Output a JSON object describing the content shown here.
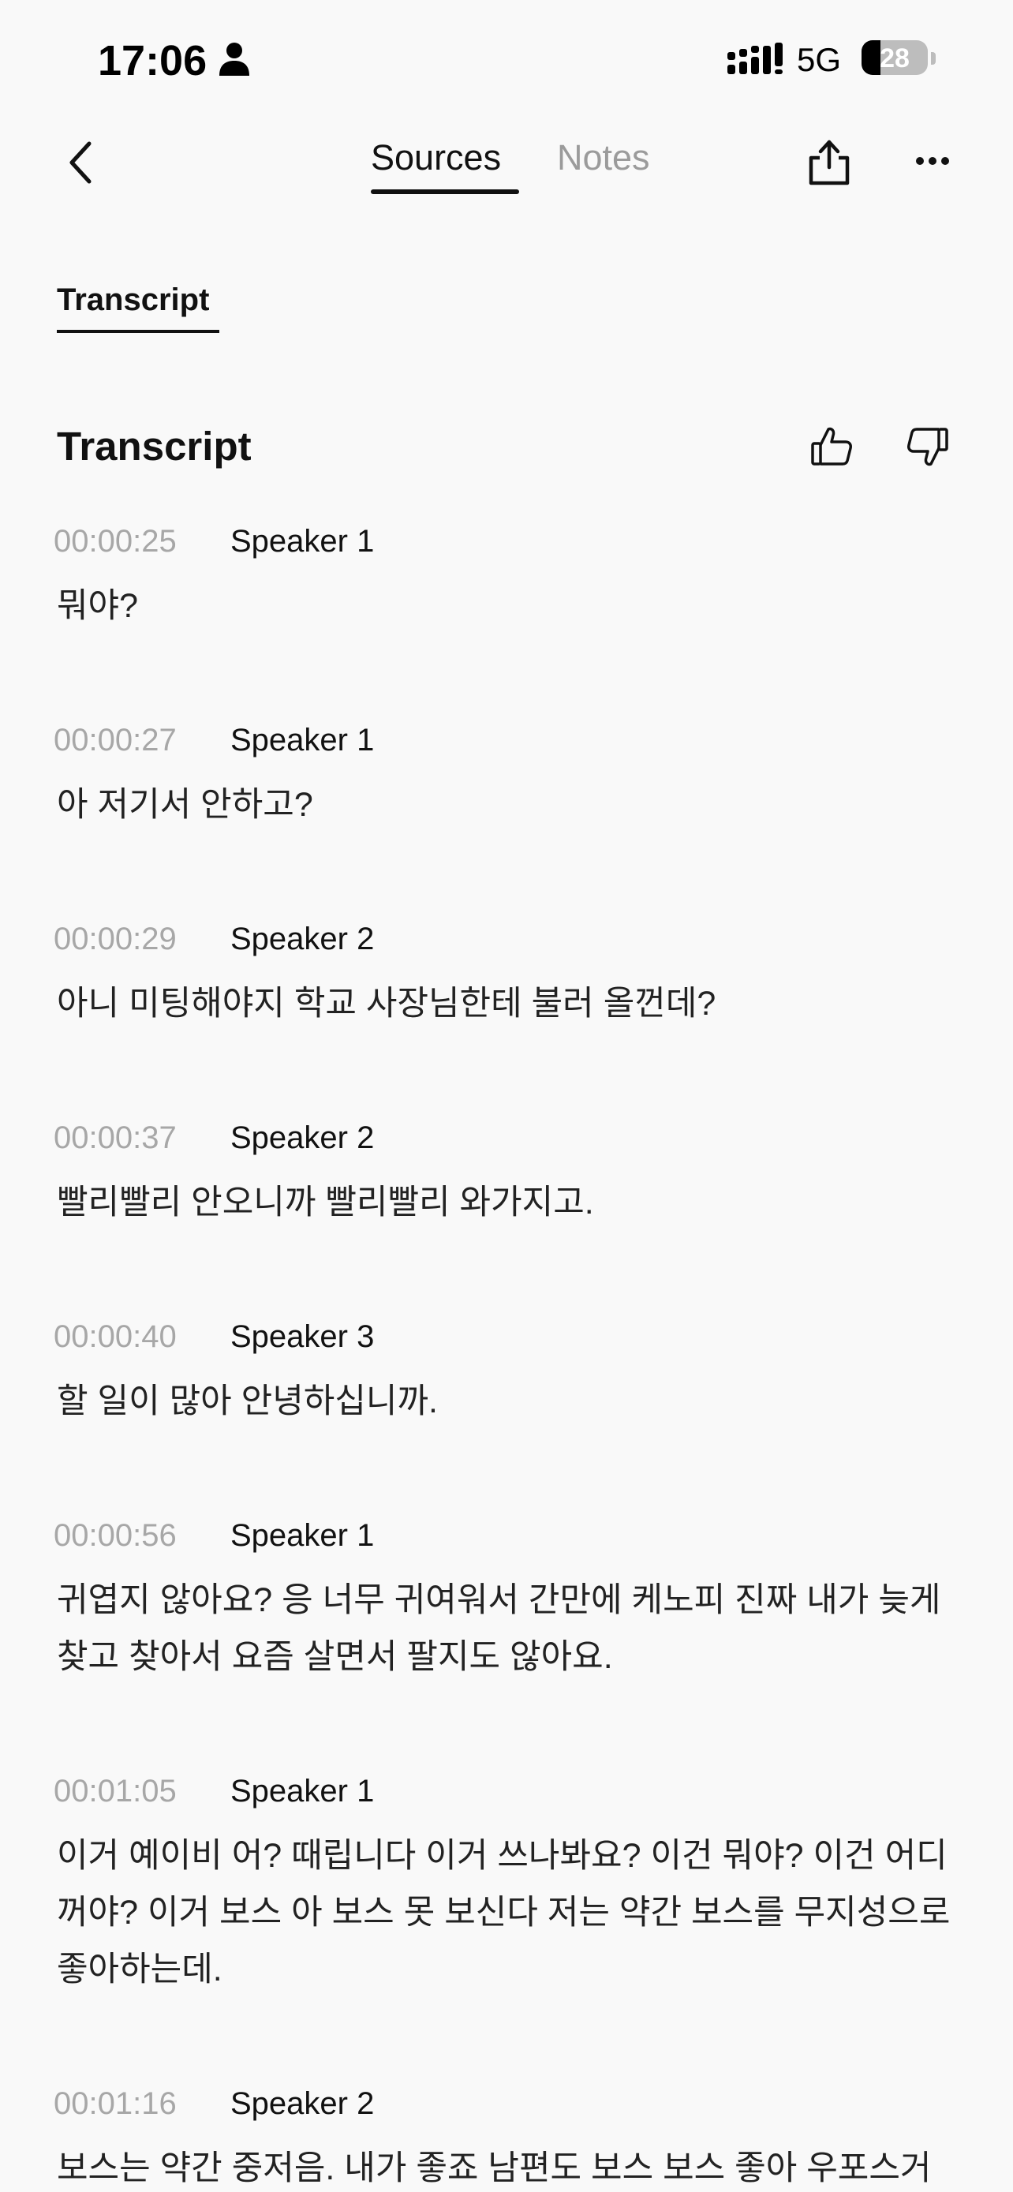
{
  "status_bar": {
    "time": "17:06",
    "network": "5G",
    "battery": "28",
    "battery_level": 0.28,
    "icons": [
      "person-icon",
      "signal-icon"
    ]
  },
  "nav": {
    "tabs": [
      {
        "label": "Sources",
        "active": true
      },
      {
        "label": "Notes",
        "active": false
      }
    ],
    "icons": [
      "back-chevron-icon",
      "share-icon",
      "more-icon"
    ]
  },
  "subtab": {
    "label": "Transcript"
  },
  "section": {
    "title": "Transcript",
    "icons": [
      "thumbs-up-icon",
      "thumbs-down-icon"
    ]
  },
  "transcript": [
    {
      "time": "00:00:25",
      "speaker": "Speaker 1",
      "text": "뭐야?"
    },
    {
      "time": "00:00:27",
      "speaker": "Speaker 1",
      "text": "아 저기서 안하고?"
    },
    {
      "time": "00:00:29",
      "speaker": "Speaker 2",
      "text": "아니 미팅해야지 학교 사장님한테 불러 올껀데?"
    },
    {
      "time": "00:00:37",
      "speaker": "Speaker 2",
      "text": "빨리빨리 안오니까 빨리빨리 와가지고."
    },
    {
      "time": "00:00:40",
      "speaker": "Speaker 3",
      "text": "할 일이 많아 안녕하십니까."
    },
    {
      "time": "00:00:56",
      "speaker": "Speaker 1",
      "text": "귀엽지 않아요? 응 너무 귀여워서 간만에 케노피 진짜 내가 늦게 찾고 찾아서 요즘 살면서 팔지도 않아요."
    },
    {
      "time": "00:01:05",
      "speaker": "Speaker 1",
      "text": "이거 예이비 어? 때립니다 이거 쓰나봐요? 이건 뭐야? 이건 어디꺼야? 이거 보스 아 보스 못 보신다 저는 약간 보스를 무지성으로 좋아하는데."
    },
    {
      "time": "00:01:16",
      "speaker": "Speaker 2",
      "text": "보스는 약간 중저음. 내가 좋죠 남편도 보스 보스 좋아 우포스거"
    }
  ],
  "colors": {
    "background": "#f9f9f9",
    "text": "#111111",
    "muted": "#a7a7a7"
  }
}
